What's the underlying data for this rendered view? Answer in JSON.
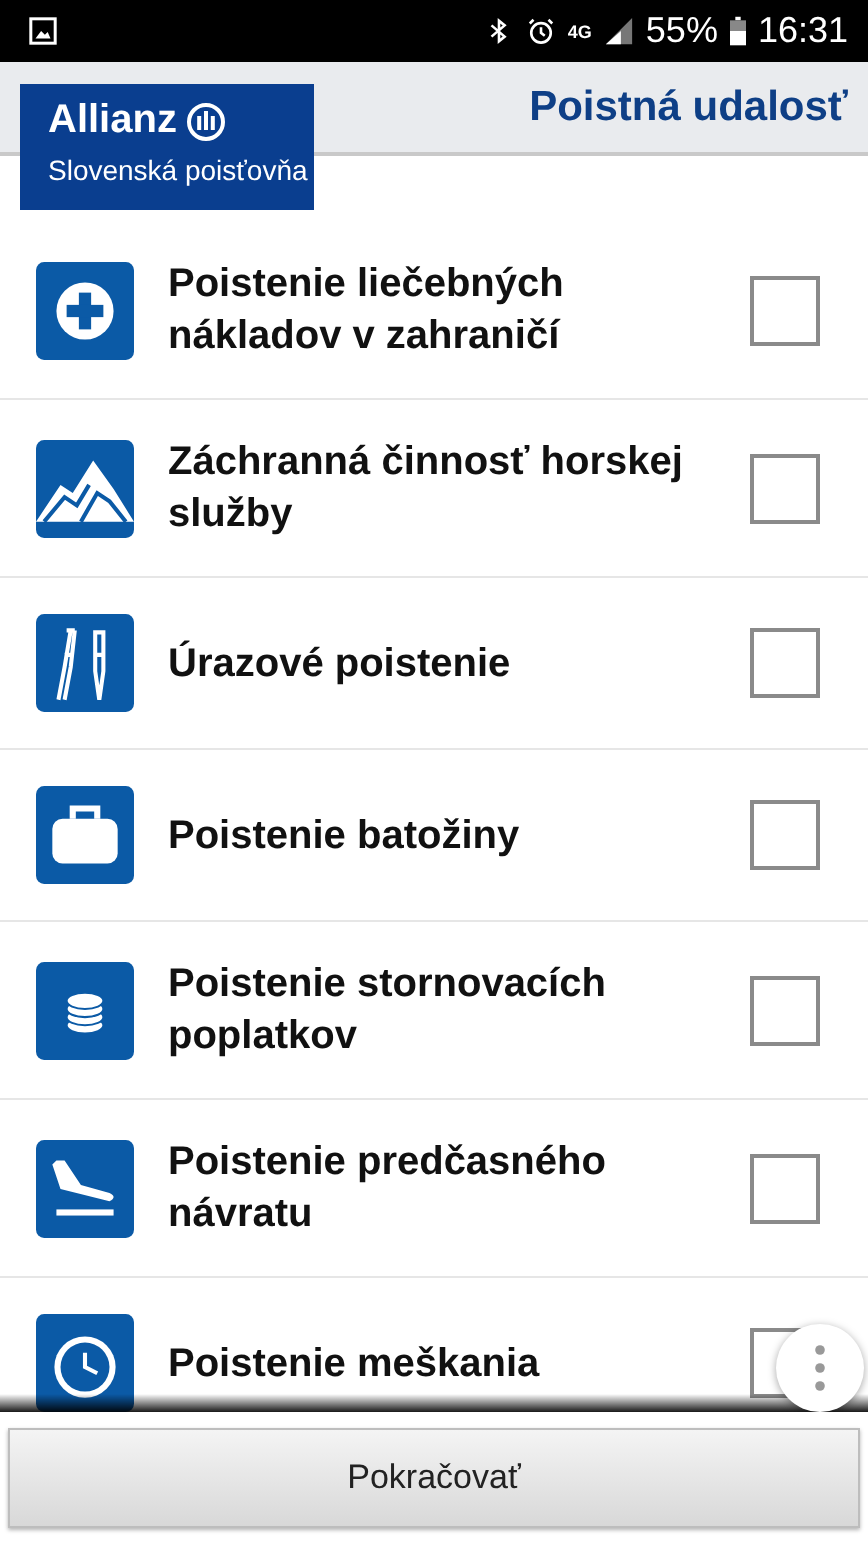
{
  "status_bar": {
    "network": "4G",
    "battery": "55%",
    "time": "16:31"
  },
  "header": {
    "logo_title": "Allianz",
    "logo_subtitle": "Slovenská poisťovňa",
    "title": "Poistná udalosť"
  },
  "items": [
    {
      "kind": "medical",
      "label": "Poistenie liečebných nákladov v zahraničí",
      "checked": false
    },
    {
      "kind": "mountain",
      "label": "Záchranná činnosť horskej služby",
      "checked": false
    },
    {
      "kind": "crutches",
      "label": "Úrazové poistenie",
      "checked": false
    },
    {
      "kind": "luggage",
      "label": "Poistenie batožiny",
      "checked": false
    },
    {
      "kind": "coins",
      "label": "Poistenie stornovacích poplatkov",
      "checked": false
    },
    {
      "kind": "plane",
      "label": "Poistenie predčasného návratu",
      "checked": false
    },
    {
      "kind": "clock",
      "label": "Poistenie meškania",
      "checked": false
    }
  ],
  "button": "Pokračovať"
}
